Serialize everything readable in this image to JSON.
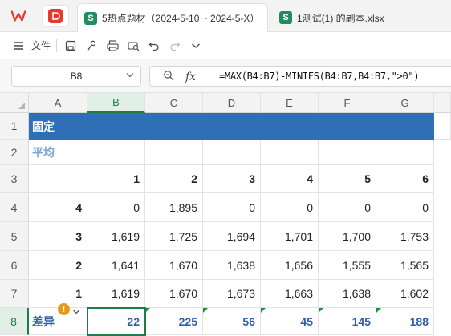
{
  "tabs": [
    {
      "label": "5热点题材（2024-5-10 ~ 2024-5-X）",
      "badge": "S"
    },
    {
      "label": "1测试(1) 的副本.xlsx",
      "badge": "S"
    }
  ],
  "toolbar": {
    "file_label": "文件"
  },
  "formula_bar": {
    "cell_ref": "B8",
    "fx_label": "fx",
    "formula": "=MAX(B4:B7)-MINIFS(B4:B7,B4:B7,\">0\")"
  },
  "columns": [
    "A",
    "B",
    "C",
    "D",
    "E",
    "F",
    "G"
  ],
  "rows": [
    "1",
    "2",
    "3",
    "4",
    "5",
    "6",
    "7",
    "8"
  ],
  "sheet": {
    "title": "固定",
    "avg_label": "平均",
    "diff_label": "差异",
    "header_row": [
      "1",
      "2",
      "3",
      "4",
      "5",
      "6"
    ],
    "data": [
      {
        "label": "4",
        "values": [
          "0",
          "1,895",
          "0",
          "0",
          "0",
          "0"
        ]
      },
      {
        "label": "3",
        "values": [
          "1,619",
          "1,725",
          "1,694",
          "1,701",
          "1,700",
          "1,753"
        ]
      },
      {
        "label": "2",
        "values": [
          "1,641",
          "1,670",
          "1,638",
          "1,656",
          "1,555",
          "1,565"
        ]
      },
      {
        "label": "1",
        "values": [
          "1,619",
          "1,670",
          "1,673",
          "1,663",
          "1,638",
          "1,602"
        ]
      }
    ],
    "diff_values": [
      "22",
      "225",
      "56",
      "45",
      "145",
      "188"
    ]
  },
  "colors": {
    "title_fill": "#2f6fb5",
    "avg_text": "#7aa6d6",
    "diff_text": "#2f5fa8",
    "selection": "#1e7e46",
    "wps_red": "#e8392d"
  }
}
